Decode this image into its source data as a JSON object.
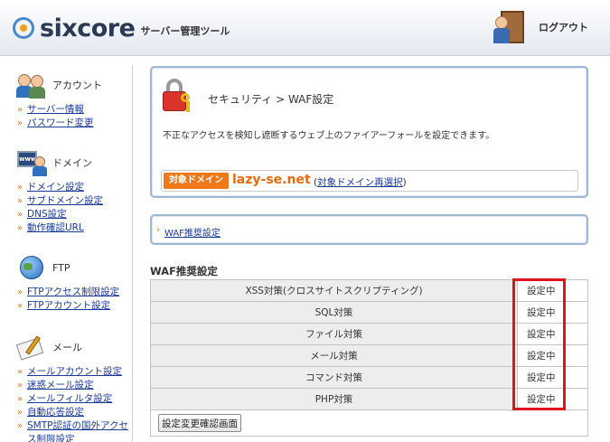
{
  "header": {
    "logo_text": "sixcore",
    "logo_subtitle": "サーバー管理ツール",
    "logout_label": "ログアウト"
  },
  "sidebar": {
    "sections": [
      {
        "title": "アカウント",
        "icon": "account-icon",
        "links": [
          "サーバー情報",
          "パスワード変更"
        ]
      },
      {
        "title": "ドメイン",
        "icon": "domain-icon",
        "links": [
          "ドメイン設定",
          "サブドメイン設定",
          "DNS設定",
          "動作確認URL"
        ]
      },
      {
        "title": "FTP",
        "icon": "ftp-globe-icon",
        "links": [
          "FTPアクセス制限設定",
          "FTPアカウント設定"
        ]
      },
      {
        "title": "メール",
        "icon": "mail-icon",
        "links": [
          "メールアカウント設定",
          "迷惑メール設定",
          "メールフィルタ設定",
          "自動応答設定",
          "SMTP認証の国外アクセス制限設定"
        ]
      }
    ]
  },
  "main": {
    "breadcrumb": "セキュリティ > WAF設定",
    "description": "不正なアクセスを検知し遮断するウェブ上のファイアーフォールを設定できます。",
    "domain_badge": "対象ドメイン",
    "domain_name": "lazy-se.net",
    "domain_reselect_open": "(",
    "domain_reselect_link": "対象ドメイン再選択",
    "domain_reselect_close": ")",
    "subnav_link": "WAF推奨設定",
    "section_title": "WAF推奨設定",
    "rows": [
      {
        "name": "XSS対策(クロスサイトスクリプティング)",
        "status": "設定中"
      },
      {
        "name": "SQL対策",
        "status": "設定中"
      },
      {
        "name": "ファイル対策",
        "status": "設定中"
      },
      {
        "name": "メール対策",
        "status": "設定中"
      },
      {
        "name": "コマンド対策",
        "status": "設定中"
      },
      {
        "name": "PHP対策",
        "status": "設定中"
      }
    ],
    "confirm_button": "設定変更確認画面"
  },
  "colors": {
    "accent_orange": "#f07818",
    "highlight_red": "#e0141e",
    "panel_border": "#9fb6d4"
  }
}
